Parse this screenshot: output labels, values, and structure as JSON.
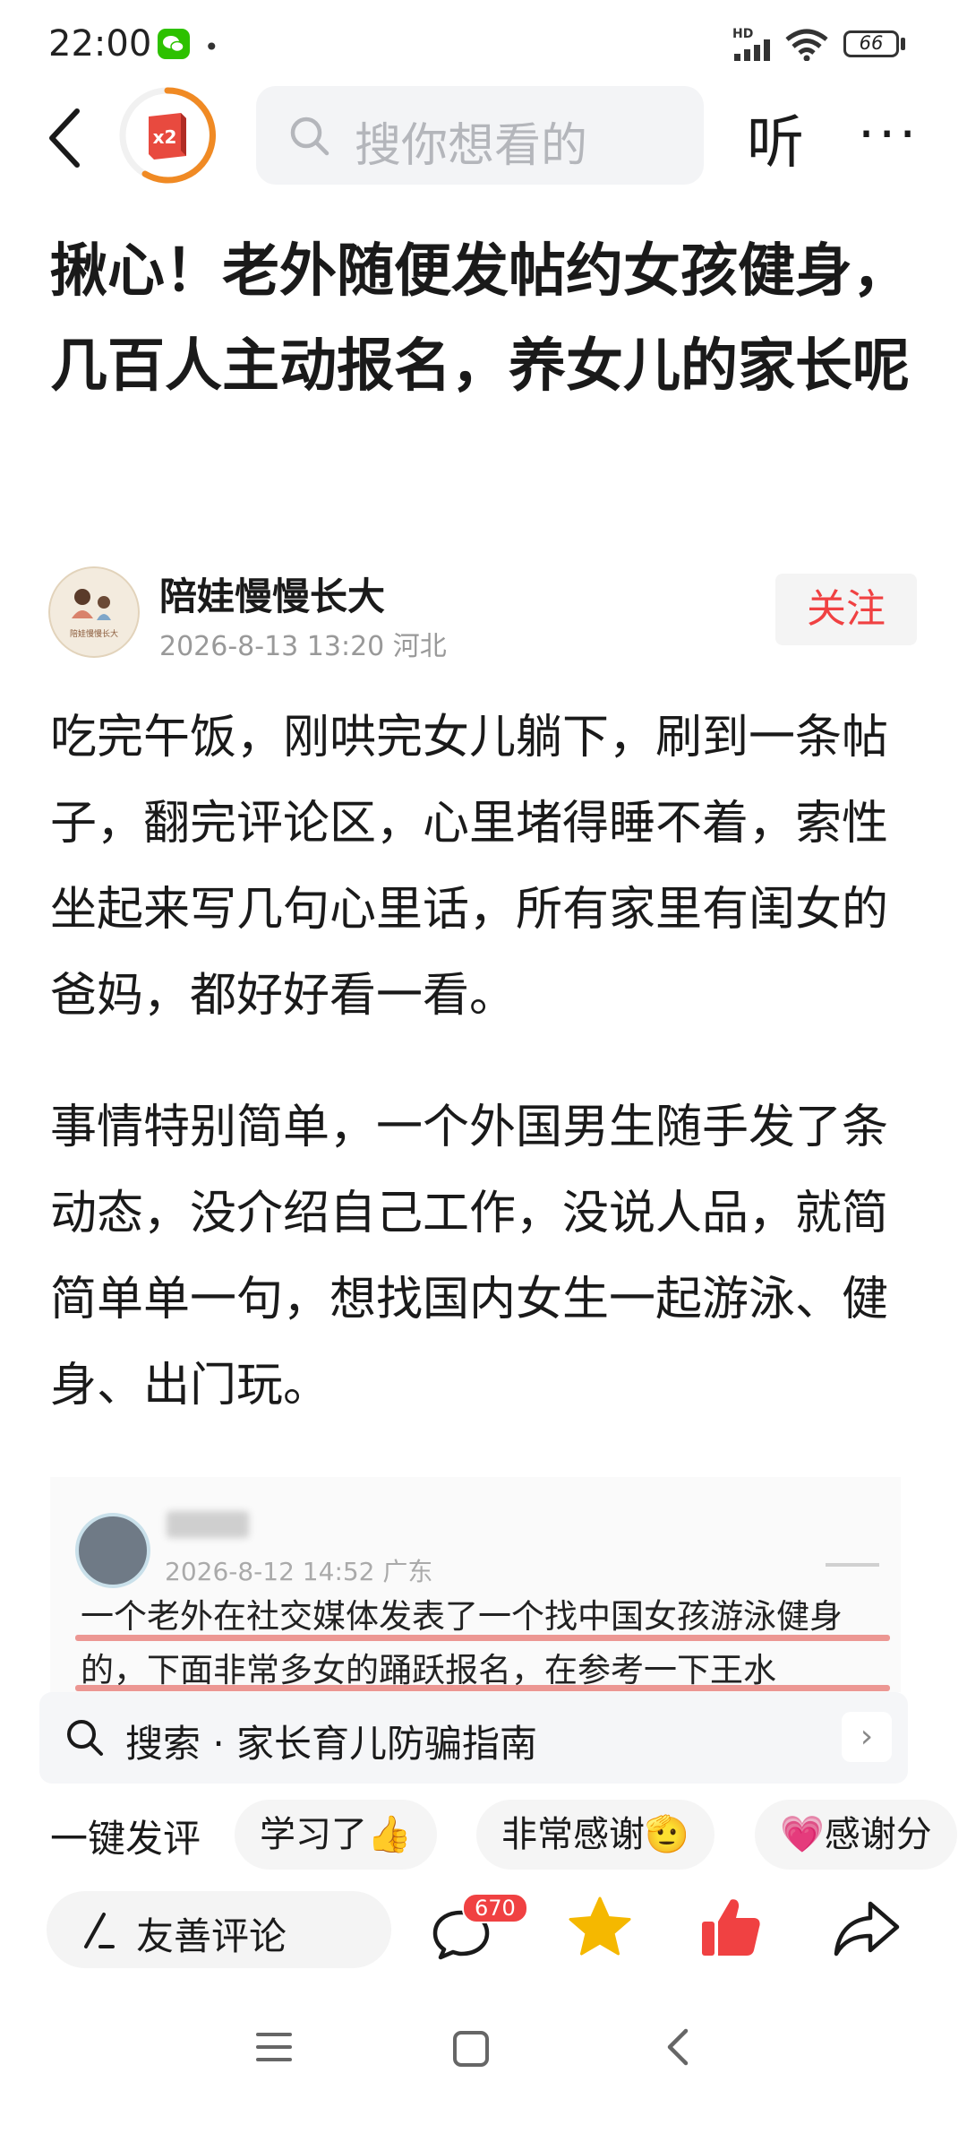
{
  "status_bar": {
    "time": "22:00",
    "network": "HD",
    "battery": "66",
    "icons": [
      "wechat-icon",
      "signal-icon",
      "wifi-icon",
      "battery-icon"
    ]
  },
  "top_nav": {
    "reward_badge": "x2",
    "search_placeholder": "搜你想看的",
    "listen_label": "听",
    "more_label": "···"
  },
  "article": {
    "title": "揪心！老外随便发帖约女孩健身，几百人主动报名，养女儿的家长呢",
    "author": {
      "name": "陪娃慢慢长大",
      "avatar_text": "陪娃慢慢长大",
      "meta": "2026-8-13  13:20  河北",
      "follow_label": "关注"
    },
    "paragraphs": [
      "吃完午饭，刚哄完女儿躺下，刷到一条帖子，翻完评论区，心里堵得睡不着，索性坐起来写几句心里话，所有家里有闺女的爸妈，都好好看一看。",
      "事情特别简单，一个外国男生随手发了条动态，没介绍自己工作，没说人品，就简简单单一句，想找国内女生一起游泳、健身、出门玩。"
    ],
    "embedded_post": {
      "meta": "2026-8-12 14:52  广东",
      "text": "一个老外在社交媒体发表了一个找中国女孩游泳健身的，下面非常多女的踊跃报名，在参考一下王水"
    }
  },
  "related_search": {
    "label": "搜索 · 家长育儿防骗指南"
  },
  "quick_comments": {
    "label": "一键发评",
    "chips": [
      "学习了👍",
      "非常感谢🫡",
      "💗感谢分"
    ]
  },
  "action_bar": {
    "comment_placeholder": "友善评论",
    "comment_count": "670"
  },
  "colors": {
    "accent_red": "#f04142",
    "reward_orange": "#f08a24",
    "star_yellow": "#f5b800"
  }
}
